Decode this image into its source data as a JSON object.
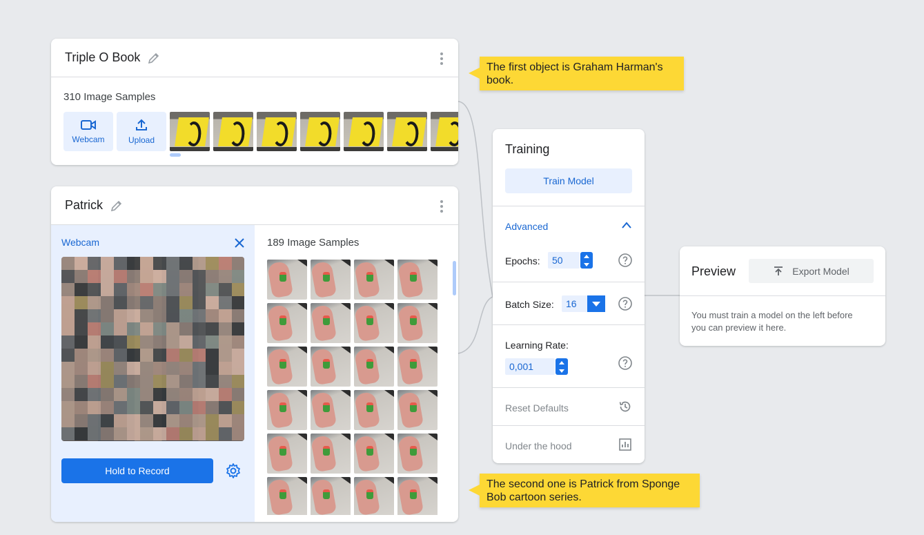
{
  "classes": [
    {
      "name": "Triple O Book",
      "samples_label": "310 Image Samples",
      "webcam_label": "Webcam",
      "upload_label": "Upload"
    },
    {
      "name": "Patrick",
      "samples_label": "189 Image Samples",
      "webcam_pane_title": "Webcam",
      "record_label": "Hold to Record"
    }
  ],
  "training": {
    "title": "Training",
    "train_button": "Train Model",
    "advanced_label": "Advanced",
    "epochs_label": "Epochs:",
    "epochs_value": "50",
    "batch_label": "Batch Size:",
    "batch_value": "16",
    "lr_label": "Learning Rate:",
    "lr_value": "0,001",
    "reset_label": "Reset Defaults",
    "hood_label": "Under the hood"
  },
  "preview": {
    "title": "Preview",
    "export_label": "Export Model",
    "message": "You must train a model on the left before you can preview it here."
  },
  "annotations": [
    "The first object is Graham Harman's book.",
    "The second one is Patrick from Sponge Bob cartoon series."
  ],
  "colors": {
    "accent": "#1a73e8",
    "accent_light": "#e8f0fe",
    "note": "#fdd835"
  }
}
